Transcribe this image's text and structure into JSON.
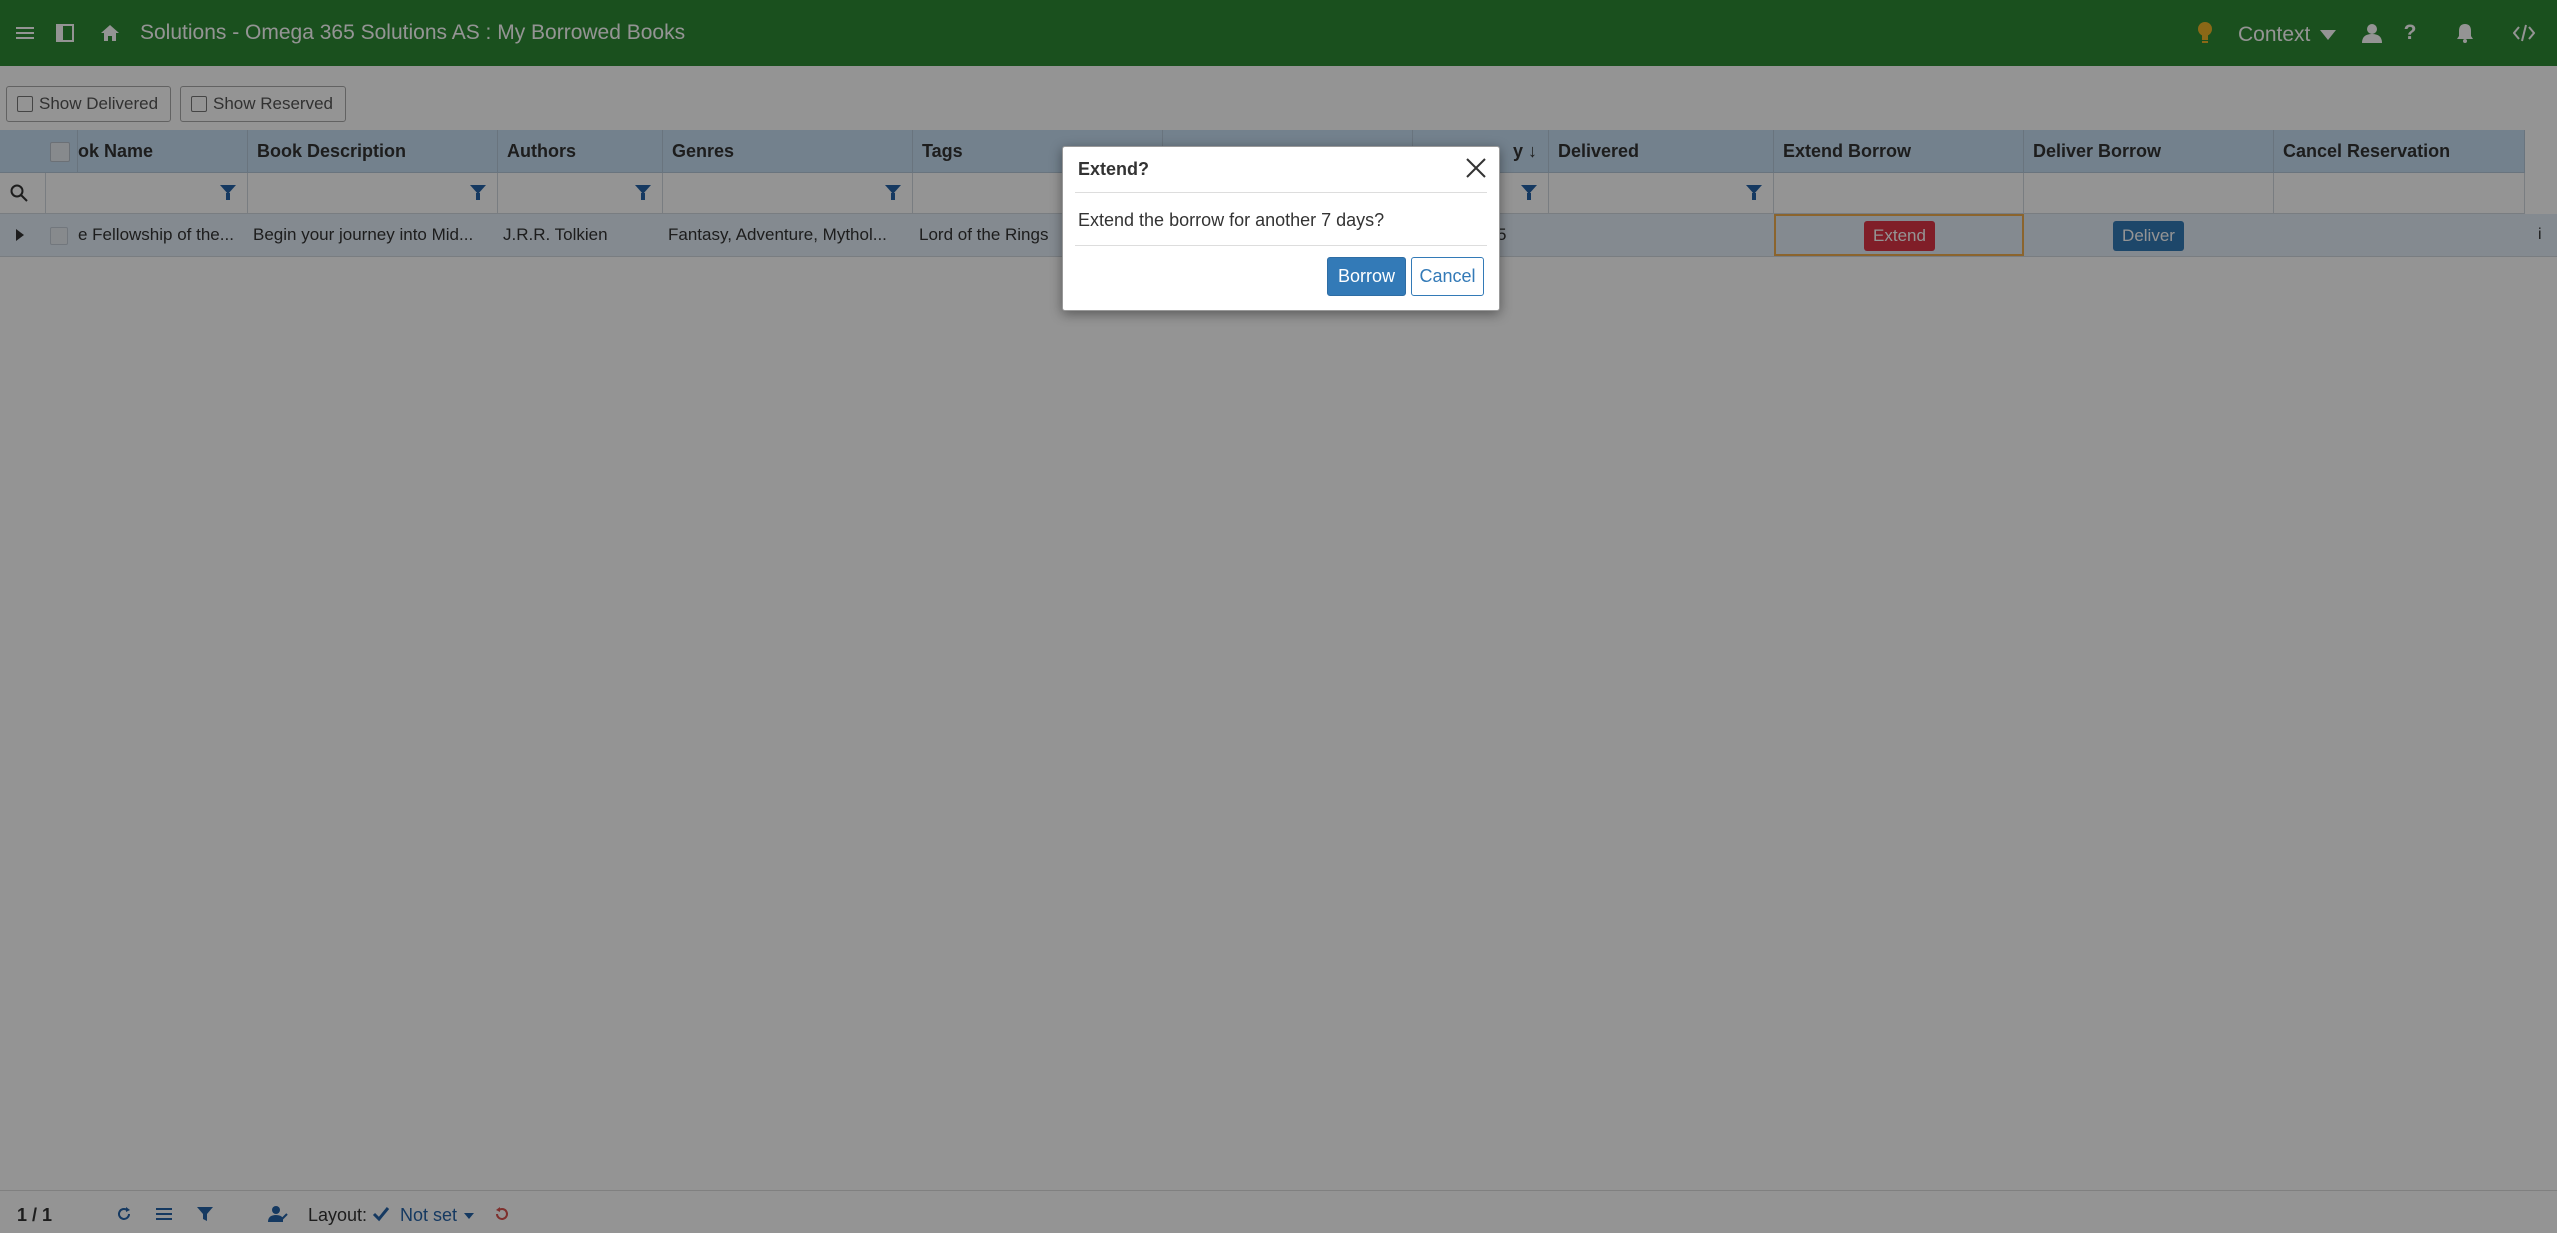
{
  "header": {
    "title": "Solutions - Omega 365 Solutions AS : My Borrowed Books",
    "context_label": "Context",
    "icons": [
      "menu-icon",
      "sidebar-toggle-icon",
      "home-icon",
      "lightbulb-icon",
      "user-icon",
      "help-icon",
      "bell-icon",
      "code-icon"
    ],
    "help_glyph": "?",
    "colors": {
      "bar": "#2e8b34",
      "bulb": "#f0b429"
    }
  },
  "toolbar": {
    "show_delivered": "Show Delivered",
    "show_reserved": "Show Reserved"
  },
  "grid": {
    "columns": [
      "ok Name",
      "Book Description",
      "Authors",
      "Genres",
      "Tags",
      "y ↓",
      "Delivered",
      "Extend Borrow",
      "Deliver Borrow",
      "Cancel Reservation"
    ],
    "rows": [
      {
        "book_name": "e Fellowship of the...",
        "book_description": "Begin your journey into Mid...",
        "authors": "J.R.R. Tolkien",
        "genres": "Fantasy, Adventure, Mythol...",
        "tags": "Lord of the Rings",
        "due_fragment": "5",
        "extend_label": "Extend",
        "deliver_label": "Deliver",
        "info_glyph": "i"
      }
    ],
    "colors": {
      "header": "#c7dff3",
      "row": "#e3eef9",
      "extend": "#dc3545",
      "deliver": "#337ab7"
    }
  },
  "footer": {
    "paging": "1 / 1",
    "layout_label": "Layout:",
    "layout_value": "Not set",
    "icons": [
      "refresh-icon",
      "list-icon",
      "filter-icon",
      "user-settings-icon",
      "check-icon",
      "reset-icon"
    ]
  },
  "dialog": {
    "title": "Extend?",
    "message": "Extend the borrow for another 7 days?",
    "confirm_label": "Borrow",
    "cancel_label": "Cancel"
  }
}
